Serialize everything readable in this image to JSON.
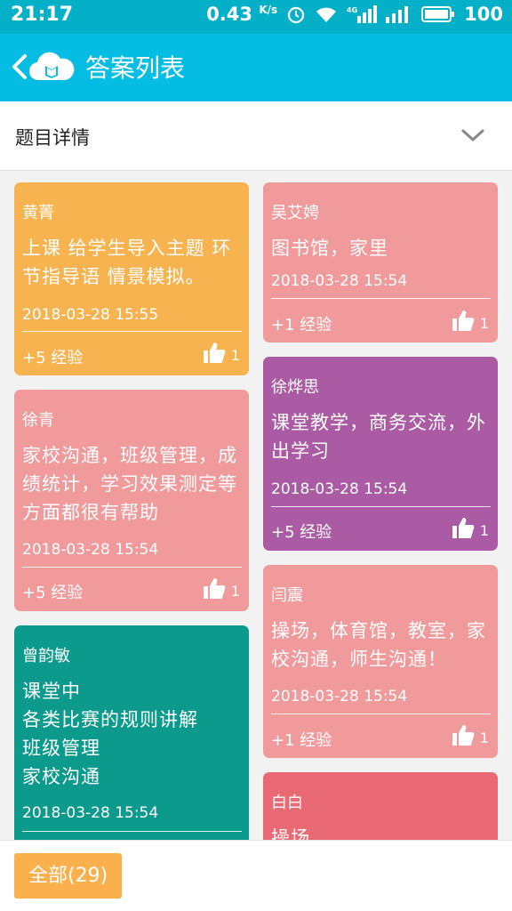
{
  "status_bar": {
    "time": "21:17",
    "speed": "0.43",
    "speed_unit": "K/s",
    "battery": "100"
  },
  "header": {
    "title": "答案列表"
  },
  "detail": {
    "label": "题目详情"
  },
  "colors": {
    "header_bg": "#05bde2",
    "card_orange": "#f7b34f",
    "card_pink": "#f09a9c",
    "card_purple": "#ab5ba3",
    "card_teal": "#0b9a8c",
    "card_red": "#e96974",
    "button_orange": "#fab04c"
  },
  "cards": [
    {
      "author": "黄菁",
      "content": "上课 给学生导入主题 环\n节指导语 情景模拟。",
      "date": "2018-03-28 15:55",
      "exp": "+5 经验",
      "likes": "1"
    },
    {
      "author": "吴艾娉",
      "content": "图书馆，家里",
      "date": "2018-03-28 15:54",
      "exp": "+1 经验",
      "likes": "1"
    },
    {
      "author": "徐烨思",
      "content": "课堂教学，商务交流，外\n出学习",
      "date": "2018-03-28 15:54",
      "exp": "+5 经验",
      "likes": "1"
    },
    {
      "author": "徐青",
      "content": "家校沟通，班级管理，成\n绩统计，学习效果测定等\n方面都很有帮助",
      "date": "2018-03-28 15:54",
      "exp": "+5 经验",
      "likes": "1"
    },
    {
      "author": "闫震",
      "content": "操场，体育馆，教室，家\n校沟通，师生沟通！",
      "date": "2018-03-28 15:54",
      "exp": "+1 经验",
      "likes": "1"
    },
    {
      "author": "曾韵敏",
      "content": "课堂中\n各类比赛的规则讲解\n班级管理\n家校沟通",
      "date": "2018-03-28 15:54",
      "exp": "",
      "likes": ""
    },
    {
      "author": "白白",
      "content": "操场",
      "date": "",
      "exp": "",
      "likes": ""
    }
  ],
  "bottom": {
    "all_label": "全部(29)"
  }
}
